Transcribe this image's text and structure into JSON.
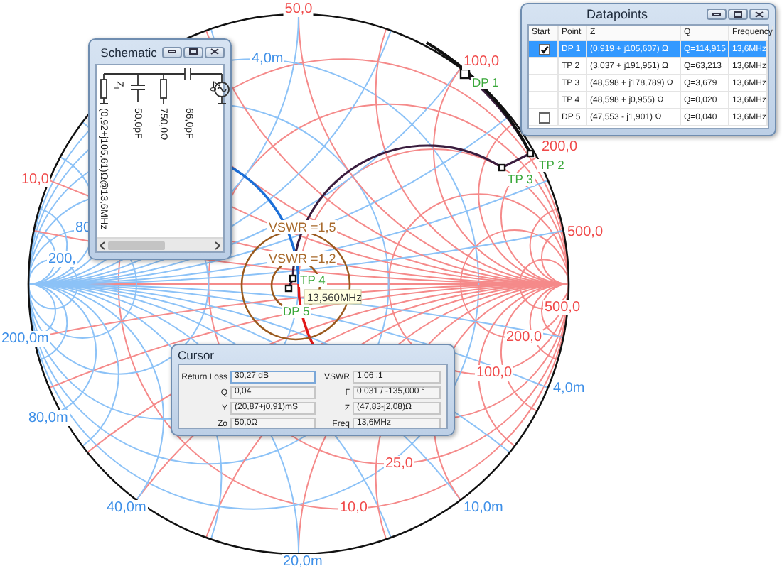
{
  "chart": {
    "scale_labels": [
      {
        "text": "50,0",
        "kind": "impedance"
      },
      {
        "text": "100,0",
        "kind": "impedance"
      },
      {
        "text": "200,0",
        "kind": "impedance"
      },
      {
        "text": "500,0",
        "kind": "impedance"
      },
      {
        "text": "500,0",
        "kind": "impedance"
      },
      {
        "text": "200,0",
        "kind": "impedance"
      },
      {
        "text": "100,0",
        "kind": "impedance"
      },
      {
        "text": "25,0",
        "kind": "impedance"
      },
      {
        "text": "10,0",
        "kind": "impedance"
      },
      {
        "text": "10,0",
        "kind": "impedance"
      },
      {
        "text": "4,0m",
        "kind": "admittance"
      },
      {
        "text": "4,0m",
        "kind": "admittance"
      },
      {
        "text": "80",
        "kind": "admittance"
      },
      {
        "text": "200,",
        "kind": "admittance"
      },
      {
        "text": "200,0m",
        "kind": "admittance"
      },
      {
        "text": "80,0m",
        "kind": "admittance"
      },
      {
        "text": "40,0m",
        "kind": "admittance"
      },
      {
        "text": "20,0m",
        "kind": "admittance"
      },
      {
        "text": "10,0m",
        "kind": "admittance"
      }
    ],
    "vswr_circles": [
      {
        "label": "VSWR =1,5"
      },
      {
        "label": "VSWR =1,2"
      }
    ],
    "points": [
      {
        "label": "DP 1"
      },
      {
        "label": "TP 2"
      },
      {
        "label": "TP 3"
      },
      {
        "label": "TP 4"
      },
      {
        "label": "DP 5"
      }
    ],
    "cursor_tooltip": "13,560MHz"
  },
  "schematic": {
    "title": "Schematic",
    "load_label": "Z$_{L}$",
    "load_value": "(0,92+j105,61)Ω@13,6MHz",
    "components": [
      {
        "kind": "capacitor",
        "value": "50,0pF"
      },
      {
        "kind": "resistor",
        "value": "750,0Ω"
      },
      {
        "kind": "capacitor",
        "value": "66,0pF"
      }
    ],
    "source_label": "Z$_{0}$"
  },
  "datapoints": {
    "title": "Datapoints",
    "columns": [
      "Start",
      "Point",
      "Z",
      "Q",
      "Frequency"
    ],
    "rows": [
      {
        "kind": "checkbox",
        "checked": true,
        "selected": true,
        "point": "DP 1",
        "z": "(0,919 + j105,607) Ω",
        "q": "Q=114,915",
        "frequency": "13,6MHz"
      },
      {
        "kind": "plain",
        "selected": false,
        "point": "TP 2",
        "z": "(3,037 + j191,951) Ω",
        "q": "Q=63,213",
        "frequency": "13,6MHz"
      },
      {
        "kind": "plain",
        "selected": false,
        "point": "TP 3",
        "z": "(48,598 + j178,789) Ω",
        "q": "Q=3,679",
        "frequency": "13,6MHz"
      },
      {
        "kind": "plain",
        "selected": false,
        "point": "TP 4",
        "z": "(48,598 + j0,955) Ω",
        "q": "Q=0,020",
        "frequency": "13,6MHz"
      },
      {
        "kind": "checkbox",
        "checked": false,
        "selected": false,
        "point": "DP 5",
        "z": "(47,553 - j1,901) Ω",
        "q": "Q=0,040",
        "frequency": "13,6MHz"
      }
    ]
  },
  "cursor": {
    "title": "Cursor",
    "fields": [
      {
        "label": "Return Loss",
        "value": "30,27 dB"
      },
      {
        "label": "VSWR",
        "value": "1,06 :1"
      },
      {
        "label": "Q",
        "value": "0,04"
      },
      {
        "label": "Γ",
        "value": "0,031 / -135,000 °"
      },
      {
        "label": "Y",
        "value": "(20,87+j0,91)mS"
      },
      {
        "label": "Z",
        "value": "(47,83-j2,08)Ω"
      },
      {
        "label": "Zo",
        "value": "50,0Ω"
      },
      {
        "label": "Freq",
        "value": "13,6MHz"
      }
    ]
  }
}
